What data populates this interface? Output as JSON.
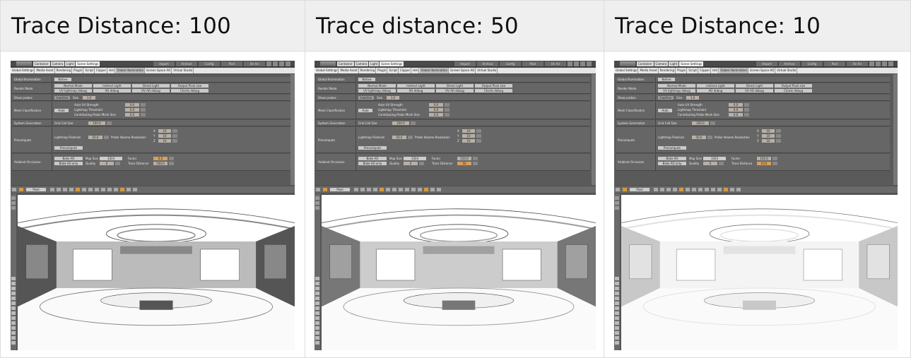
{
  "panels": [
    {
      "title": "Trace Distance: 100",
      "trace_value": "100.0",
      "factor_value": "0.5"
    },
    {
      "title": "Trace distance: 50",
      "trace_value": "50",
      "factor_value": "150.0"
    },
    {
      "title": "Trace Distance: 10",
      "trace_value": "10.0",
      "factor_value": "150.0"
    }
  ],
  "ui": {
    "top_tabs": [
      "Container",
      "Camera",
      "Light",
      "Scene Settings"
    ],
    "top_buttons": [
      "Import",
      "Archive",
      "Config",
      "Post",
      "On Air"
    ],
    "sub_tabs": [
      "Global Settings",
      "Media Asset",
      "Rendering",
      "Plugin",
      "Script",
      "Clipper",
      "Hdr",
      "Global Illumination",
      "Screen Space AO",
      "Virtual Studio"
    ],
    "rows": {
      "gi": {
        "label": "Global Illumination",
        "button": "Native"
      },
      "render_mode": {
        "label": "Render Mode",
        "buttons": [
          "Normal Mode",
          "Indirect Light",
          "Direct Light",
          "Output Pixel size",
          "UV lightmap debug",
          "AO debug",
          "UV AO debug",
          "Charts debug"
        ]
      },
      "show_probes": {
        "label": "Show probes",
        "button": "Inactive",
        "size_label": "Size",
        "size_value": "1.0"
      },
      "mesh": {
        "label": "Mesh Classification",
        "button": "Auto",
        "fields": [
          "Auto UV Strength",
          "Lightmap Threshold",
          "Contributing Probe Mesh Size"
        ],
        "values": [
          "0.0",
          "0.0",
          "0.0"
        ]
      },
      "system": {
        "label": "System Generation",
        "cell_label": "Grid Cell Size",
        "cell_value": "100.0"
      },
      "precompute": {
        "label": "Precompute",
        "pixelsize_label": "Lightmap Pixelsize",
        "pixelsize_value": "50.0",
        "probe_label": "Probe Volume Resolution",
        "xyz": [
          "X",
          "Y",
          "Z"
        ],
        "xyz_values": [
          "10",
          "10",
          "10"
        ],
        "button": "Precompute"
      },
      "ao": {
        "label": "Ambient Occlusion",
        "bake_button": "Bake AO",
        "bake_only": "Bake AO only",
        "map_size_label": "Map Size",
        "map_size_value": "1024",
        "quality_label": "Quality",
        "quality_value": "0",
        "factor_label": "Factor",
        "trace_label": "Trace Distance"
      }
    },
    "toolbar_label": "Pixel"
  }
}
